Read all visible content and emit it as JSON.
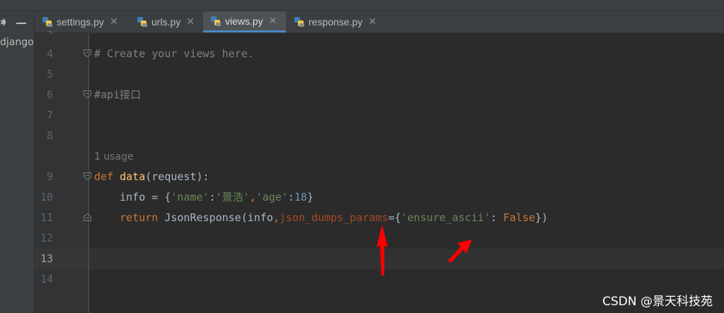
{
  "left_panel": {
    "project_label": "django"
  },
  "tabs": [
    {
      "label": "settings.py",
      "active": false
    },
    {
      "label": "urls.py",
      "active": false
    },
    {
      "label": "views.py",
      "active": true
    },
    {
      "label": "response.py",
      "active": false
    }
  ],
  "editor": {
    "partial_top_line_number": "3",
    "current_line": 13,
    "line_numbers": [
      "4",
      "5",
      "6",
      "7",
      "8",
      "9",
      "10",
      "11",
      "12",
      "13",
      "14"
    ],
    "inlay_hint": "1 usage",
    "code": {
      "line4_comment": "# Create your views here.",
      "line6_comment": "#api接口",
      "line9": {
        "kw_def": "def",
        "fn_name": "data",
        "rest": "(request):"
      },
      "line10": {
        "indent": "    ",
        "a": "info = {",
        "s1": "'name'",
        "b": ":",
        "s2": "'景浩'",
        "c": ",",
        "s3": "'age'",
        "d": ":",
        "n1": "18",
        "e": "}"
      },
      "line11": {
        "indent": "    ",
        "kw_return": "return",
        "a": " JsonResponse(info",
        "comma": ",",
        "param": "json_dumps_params",
        "b": "={",
        "s1": "'ensure_ascii'",
        "c": ": ",
        "kw_false": "False",
        "d": "})"
      }
    }
  },
  "watermark": "CSDN @景天科技苑",
  "colors": {
    "background": "#2b2b2b",
    "gutter": "#313335",
    "keyword": "#cc7832",
    "function": "#ffc66d",
    "string": "#6a8759",
    "number": "#6897bb",
    "comment": "#808080",
    "param": "#aa4926",
    "active_tab_underline": "#4a88c7",
    "annotation_arrow": "#ff0000"
  },
  "icons": [
    "gear-icon",
    "minimize-icon",
    "python-file-icon",
    "close-icon",
    "fold-marker-icon"
  ]
}
